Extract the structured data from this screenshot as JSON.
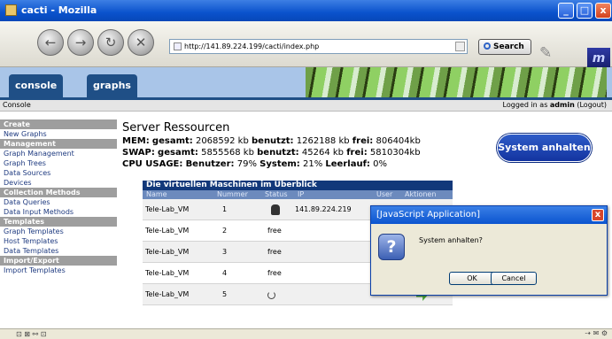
{
  "window": {
    "title": "cacti - Mozilla",
    "minimize_glyph": "_",
    "maximize_glyph": "□",
    "close_glyph": "x"
  },
  "navbar": {
    "back_glyph": "←",
    "forward_glyph": "→",
    "reload_glyph": "↻",
    "stop_glyph": "✕",
    "url": "http://141.89.224.199/cacti/index.php",
    "search_label": "Search",
    "brand_letter": "m"
  },
  "tabs": [
    {
      "label": "console"
    },
    {
      "label": "graphs"
    }
  ],
  "breadcrumb": {
    "text": "Console",
    "login_prefix": "Logged in as ",
    "user": "admin",
    "logout": "(Logout)"
  },
  "sidebar": {
    "items": [
      {
        "label": "Create",
        "header": true
      },
      {
        "label": "New Graphs",
        "header": false
      },
      {
        "label": "Management",
        "header": true
      },
      {
        "label": "Graph Management",
        "header": false
      },
      {
        "label": "Graph Trees",
        "header": false
      },
      {
        "label": "Data Sources",
        "header": false
      },
      {
        "label": "Devices",
        "header": false
      },
      {
        "label": "Collection Methods",
        "header": true
      },
      {
        "label": "Data Queries",
        "header": false
      },
      {
        "label": "Data Input Methods",
        "header": false
      },
      {
        "label": "Templates",
        "header": true
      },
      {
        "label": "Graph Templates",
        "header": false
      },
      {
        "label": "Host Templates",
        "header": false
      },
      {
        "label": "Data Templates",
        "header": false
      },
      {
        "label": "Import/Export",
        "header": true
      },
      {
        "label": "Import Templates",
        "header": false
      }
    ]
  },
  "main": {
    "title": "Server Ressourcen",
    "mem": {
      "label": "MEM:",
      "total_label": "gesamt:",
      "total": "2068592 kb",
      "used_label": "benutzt:",
      "used": "1262188 kb",
      "free_label": "frei:",
      "free": "806404kb"
    },
    "swap": {
      "label": "SWAP:",
      "total_label": "gesamt:",
      "total": "5855568 kb",
      "used_label": "benutzt:",
      "used": "45264 kb",
      "free_label": "frei:",
      "free": "5810304kb"
    },
    "cpu": {
      "label": "CPU USAGE:",
      "user_label": "Benutzer:",
      "user": "79%",
      "system_label": "System:",
      "system": "21%",
      "idle_label": "Leerlauf:",
      "idle": "0%"
    },
    "system_button": "System anhalten"
  },
  "vm_table": {
    "caption": "Die virtuellen Maschinen im Überblick",
    "columns": [
      "Name",
      "Nummer",
      "Status",
      "IP",
      "User",
      "Aktionen"
    ],
    "rows": [
      {
        "name": "Tele-Lab_VM",
        "number": "1",
        "status": "",
        "status_icon": "running-user-icon",
        "ip": "141.89.224.219"
      },
      {
        "name": "Tele-Lab_VM",
        "number": "2",
        "status": "free",
        "status_icon": "",
        "ip": ""
      },
      {
        "name": "Tele-Lab_VM",
        "number": "3",
        "status": "free",
        "status_icon": "",
        "ip": ""
      },
      {
        "name": "Tele-Lab_VM",
        "number": "4",
        "status": "free",
        "status_icon": "",
        "ip": ""
      },
      {
        "name": "Tele-Lab_VM",
        "number": "5",
        "status": "",
        "status_icon": "wait-icon",
        "ip": ""
      }
    ]
  },
  "dialog": {
    "title": "[JavaScript Application]",
    "message": "System anhalten?",
    "ok": "OK",
    "cancel": "Cancel",
    "question_glyph": "?",
    "close_glyph": "x"
  },
  "statusbar": {
    "left_icons": "⊡ ⊠ ⚯ ⊡",
    "right_icons": "⇢ ✉ ⚙"
  }
}
